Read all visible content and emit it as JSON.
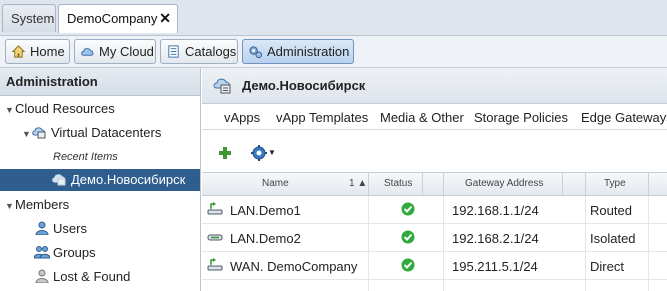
{
  "window_tabs": [
    {
      "label": "System"
    },
    {
      "label": "DemoCompany",
      "close": "✕"
    }
  ],
  "nav": {
    "home": "Home",
    "my_cloud": "My Cloud",
    "catalogs": "Catalogs",
    "administration": "Administration"
  },
  "left_panel": {
    "header": "Administration",
    "cloud_resources": "Cloud Resources",
    "virtual_datacenters": "Virtual Datacenters",
    "recent_items": "Recent Items",
    "selected_vdc": "Демо.Новосибирск",
    "members": "Members",
    "users": "Users",
    "groups": "Groups",
    "lost_found": "Lost & Found"
  },
  "right_panel": {
    "title": "Демо.Новосибирск",
    "tabs": [
      "vApps",
      "vApp Templates",
      "Media & Other",
      "Storage Policies",
      "Edge Gateways"
    ],
    "columns": {
      "name": "Name",
      "sort": "1 ▲",
      "status": "Status",
      "gateway": "Gateway Address",
      "type": "Type"
    },
    "rows": [
      {
        "name": "LAN.Demo1",
        "gateway": "192.168.1.1/24",
        "type": "Routed"
      },
      {
        "name": "LAN.Demo2",
        "gateway": "192.168.2.1/24",
        "type": "Isolated"
      },
      {
        "name": "WAN. DemoCompany",
        "gateway": "195.211.5.1/24",
        "type": "Direct"
      }
    ]
  },
  "colors": {
    "selected": "#2f5e8e",
    "ok_green": "#2eaa3c",
    "accent": "#3a78c2"
  }
}
